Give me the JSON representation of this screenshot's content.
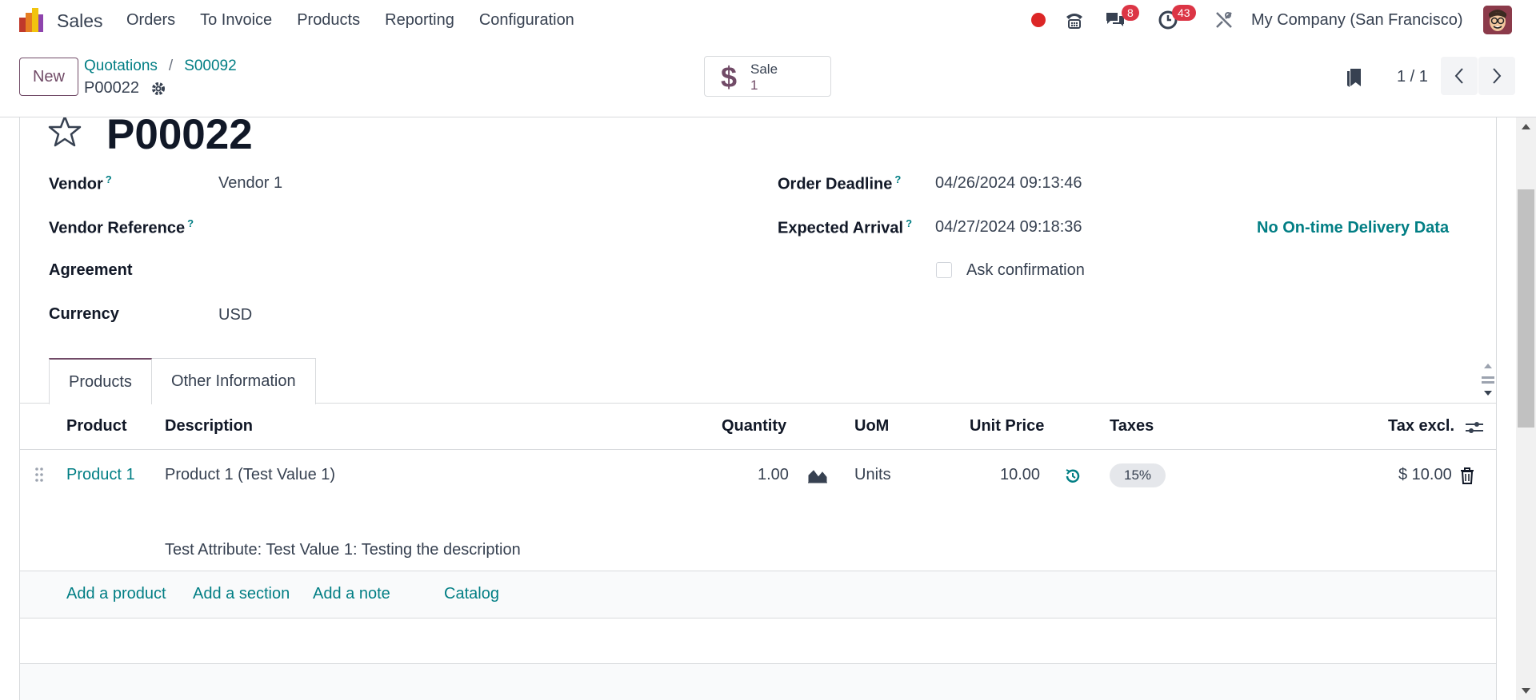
{
  "navbar": {
    "app_name": "Sales",
    "menu": [
      "Orders",
      "To Invoice",
      "Products",
      "Reporting",
      "Configuration"
    ],
    "messages_count": "8",
    "activities_count": "43",
    "company": "My Company (San Francisco)"
  },
  "control_panel": {
    "new_label": "New",
    "breadcrumb": [
      "Quotations",
      "S00092"
    ],
    "current_record": "P00022",
    "smart_button": {
      "label": "Sale",
      "value": "1"
    },
    "pager": "1 / 1"
  },
  "form": {
    "title": "P00022",
    "vendor_label": "Vendor",
    "vendor_value": "Vendor 1",
    "vendor_ref_label": "Vendor Reference",
    "agreement_label": "Agreement",
    "currency_label": "Currency",
    "currency_value": "USD",
    "order_deadline_label": "Order Deadline",
    "order_deadline_value": "04/26/2024 09:13:46",
    "expected_arrival_label": "Expected Arrival",
    "expected_arrival_value": "04/27/2024 09:18:36",
    "ontime_link": "No On-time Delivery Data",
    "ask_confirmation_label": "Ask confirmation",
    "help_mark": "?"
  },
  "tabs": [
    "Products",
    "Other Information"
  ],
  "table": {
    "headers": {
      "product": "Product",
      "description": "Description",
      "quantity": "Quantity",
      "uom": "UoM",
      "unit_price": "Unit Price",
      "taxes": "Taxes",
      "tax_excl": "Tax excl."
    },
    "row": {
      "product": "Product 1",
      "description": "Product 1 (Test Value 1)",
      "description_extra": "Test Attribute: Test Value 1: Testing the description",
      "quantity": "1.00",
      "uom": "Units",
      "unit_price": "10.00",
      "tax": "15%",
      "subtotal": "$ 10.00"
    },
    "actions": [
      "Add a product",
      "Add a section",
      "Add a note",
      "Catalog"
    ]
  },
  "colors": {
    "brand": "#714b67",
    "link": "#017e84",
    "badge": "#dc3545"
  }
}
